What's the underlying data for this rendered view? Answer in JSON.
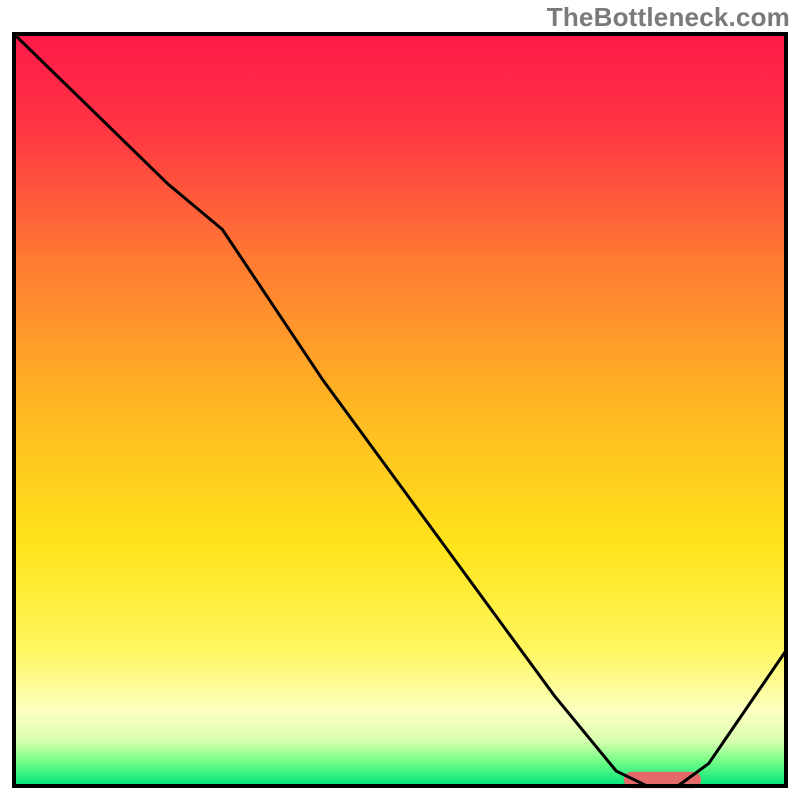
{
  "watermark": "TheBottleneck.com",
  "chart_data": {
    "type": "line",
    "title": "",
    "xlabel": "",
    "ylabel": "",
    "xlim": [
      0,
      100
    ],
    "ylim": [
      0,
      100
    ],
    "grid": false,
    "legend": false,
    "background_gradient": {
      "stops": [
        {
          "offset": 0.0,
          "color": "#ff1a4a"
        },
        {
          "offset": 0.12,
          "color": "#ff3344"
        },
        {
          "offset": 0.3,
          "color": "#ff7a33"
        },
        {
          "offset": 0.5,
          "color": "#ffb822"
        },
        {
          "offset": 0.68,
          "color": "#ffe41a"
        },
        {
          "offset": 0.82,
          "color": "#fff760"
        },
        {
          "offset": 0.9,
          "color": "#fcffc0"
        },
        {
          "offset": 0.94,
          "color": "#d9ffb0"
        },
        {
          "offset": 0.965,
          "color": "#7aff8a"
        },
        {
          "offset": 1.0,
          "color": "#00e57a"
        }
      ]
    },
    "frame_color": "#000000",
    "curve": {
      "color": "#000000",
      "stroke_width": 3,
      "x": [
        0,
        10,
        20,
        27,
        40,
        55,
        70,
        78,
        82,
        86,
        90,
        100
      ],
      "y": [
        100,
        90,
        80,
        74,
        54,
        33,
        12,
        2,
        0,
        0,
        3,
        18
      ]
    },
    "marker": {
      "shape": "capsule",
      "x_center": 84,
      "y_center": 0.8,
      "width": 10,
      "height": 2.2,
      "color": "#e46a6a"
    }
  }
}
